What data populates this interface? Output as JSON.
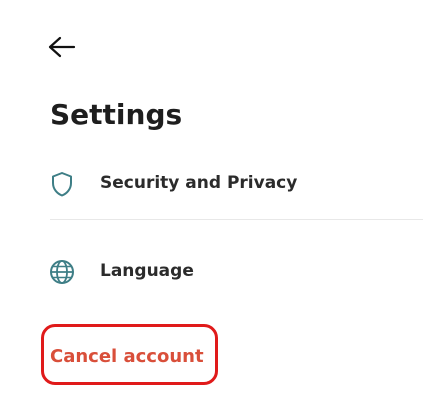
{
  "header": {
    "back_icon": "arrow-left-icon",
    "title": "Settings"
  },
  "menu": {
    "items": [
      {
        "label": "Security and Privacy",
        "icon": "shield-icon"
      },
      {
        "label": "Language",
        "icon": "globe-icon"
      }
    ]
  },
  "actions": {
    "cancel_account_label": "Cancel account"
  },
  "colors": {
    "icon_teal": "#3e7e86",
    "cancel_red": "#d94f3a",
    "annotation_red": "#e01a1a",
    "text_dark": "#1e1e1e",
    "divider": "#e8e8e8"
  }
}
